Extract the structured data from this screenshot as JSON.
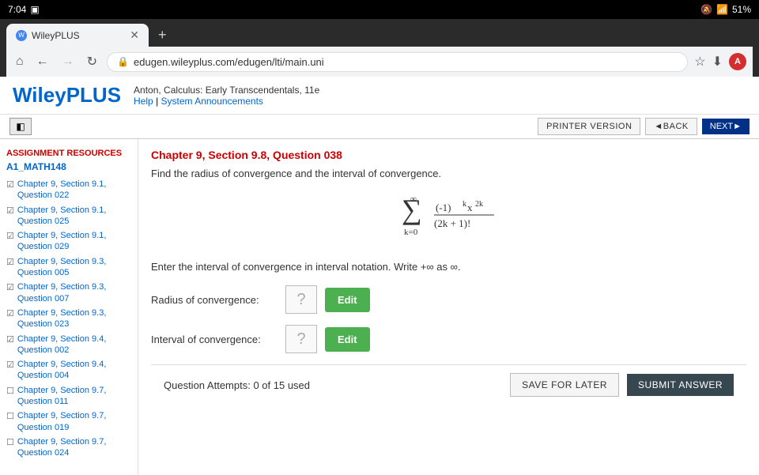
{
  "status_bar": {
    "time": "7:04",
    "battery": "51%",
    "signal": "51%"
  },
  "browser": {
    "tab_title": "WileyPLUS",
    "url": "edugen.wileyplus.com/edugen/lti/main.uni",
    "new_tab_label": "+"
  },
  "header": {
    "logo_part1": "Wiley",
    "logo_part2": "PLUS",
    "book_info": "Anton, Calculus: Early Transcendentals, 11e",
    "help_label": "Help",
    "announcements_label": "System Announcements"
  },
  "toolbar": {
    "printer_version_label": "PRINTER VERSION",
    "back_label": "◄BACK",
    "next_label": "NEXT►"
  },
  "sidebar": {
    "section_title": "ASSIGNMENT RESOURCES",
    "course_id": "A1_MATH148",
    "items": [
      {
        "id": "ch9-s1-q22",
        "label": "Chapter 9, Section 9.1, Question 022",
        "checked": true
      },
      {
        "id": "ch9-s1-q25",
        "label": "Chapter 9, Section 9.1, Question 025",
        "checked": true
      },
      {
        "id": "ch9-s1-q29",
        "label": "Chapter 9, Section 9.1, Question 029",
        "checked": true
      },
      {
        "id": "ch9-s3-q05",
        "label": "Chapter 9, Section 9.3, Question 005",
        "checked": true
      },
      {
        "id": "ch9-s3-q07",
        "label": "Chapter 9, Section 9.3, Question 007",
        "checked": true
      },
      {
        "id": "ch9-s3-q23",
        "label": "Chapter 9, Section 9.3, Question 023",
        "checked": true
      },
      {
        "id": "ch9-s4-q02",
        "label": "Chapter 9, Section 9.4, Question 002",
        "checked": true
      },
      {
        "id": "ch9-s4-q04",
        "label": "Chapter 9, Section 9.4, Question 004",
        "checked": true
      },
      {
        "id": "ch9-s7-q11",
        "label": "Chapter 9, Section 9.7, Question 011",
        "checked": false
      },
      {
        "id": "ch9-s7-q19",
        "label": "Chapter 9, Section 9.7, Question 019",
        "checked": false
      },
      {
        "id": "ch9-s7-q24",
        "label": "Chapter 9, Section 9.7, Question 024",
        "checked": false
      }
    ]
  },
  "question": {
    "header": "Chapter 9, Section 9.8, Question 038",
    "prompt": "Find the radius of convergence and the interval of convergence.",
    "interval_prompt": "Enter the interval of convergence in interval notation. Write +∞ as ∞.",
    "radius_label": "Radius of convergence:",
    "interval_label": "Interval of convergence:",
    "edit_label": "Edit",
    "attempts_text": "Question Attempts: 0 of 15 used",
    "save_label": "SAVE FOR LATER",
    "submit_label": "SUBMIT ANSWER"
  }
}
